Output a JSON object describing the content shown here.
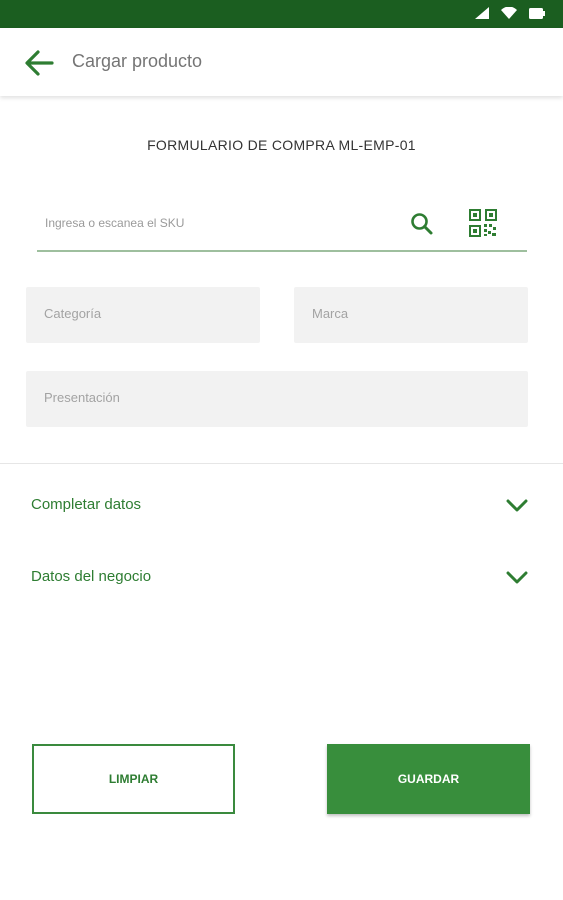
{
  "header": {
    "title": "Cargar producto"
  },
  "form": {
    "title": "FORMULARIO DE COMPRA ML-EMP-01",
    "sku": {
      "placeholder": "Ingresa o escanea el SKU",
      "value": ""
    },
    "categoria_placeholder": "Categoría",
    "marca_placeholder": "Marca",
    "presentacion_placeholder": "Presentación"
  },
  "sections": [
    {
      "label": "Completar datos"
    },
    {
      "label": "Datos del negocio"
    }
  ],
  "actions": {
    "clear_label": "LIMPIAR",
    "save_label": "GUARDAR"
  },
  "icons": {
    "back": "arrow-left-icon",
    "search": "search-icon",
    "scan": "qr-code-icon",
    "expand": "chevron-down-icon",
    "status": [
      "signal-icon",
      "wifi-icon",
      "battery-icon"
    ]
  },
  "colors": {
    "status_bar": "#1b5e20",
    "accent": "#2e7d32",
    "primary_button": "#388e3c",
    "field_background": "#f2f2f2"
  }
}
